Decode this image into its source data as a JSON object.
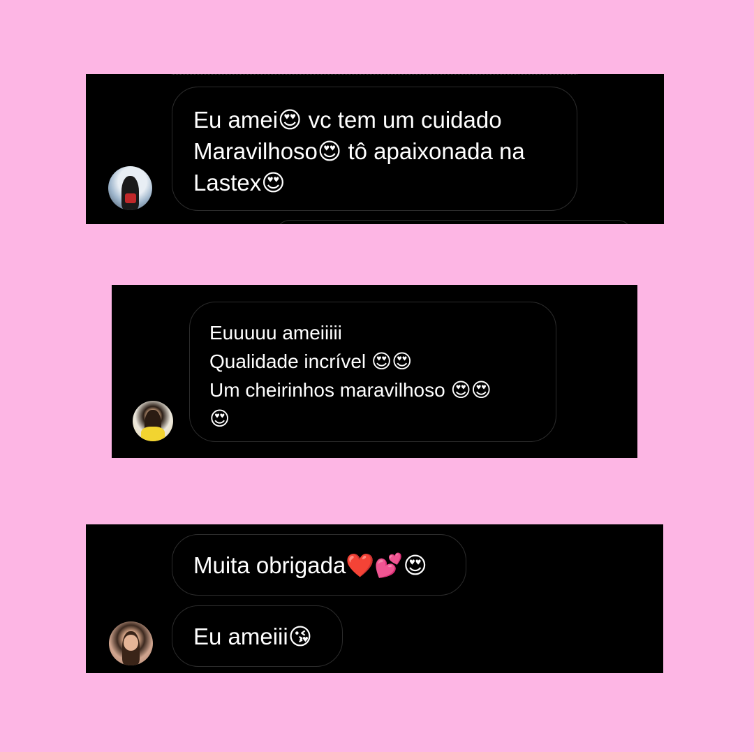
{
  "background_color": "#fdb6e4",
  "cards": [
    {
      "avatar_icon": "user-avatar-photo",
      "messages": [
        {
          "text": "Eu amei😍 vc tem um cuidado\nMaravilhoso😍 tô apaixonada na\nLastex😍"
        }
      ]
    },
    {
      "avatar_icon": "user-avatar-photo",
      "messages": [
        {
          "text": "Euuuuu ameiiiii\nQualidade  incrível 😍😍\nUm cheirinhos maravilhoso 😍😍\n😍"
        }
      ]
    },
    {
      "avatar_icon": "user-avatar-photo",
      "messages": [
        {
          "text": "Muita obrigada❤️💕😍"
        },
        {
          "text": "Eu ameiii😘"
        }
      ]
    }
  ]
}
